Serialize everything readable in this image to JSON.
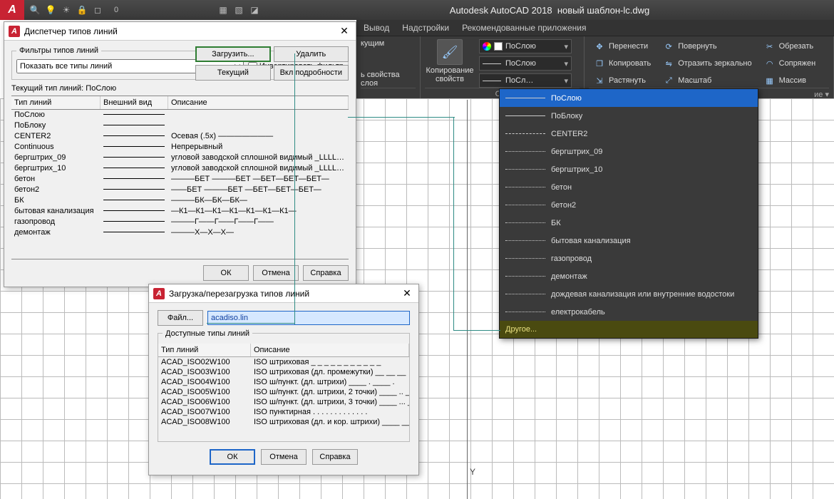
{
  "app": {
    "name": "Autodesk AutoCAD 2018",
    "doc": "новый шаблон-lc.dwg",
    "layer0": "0"
  },
  "menu": {
    "items": [
      "Вывод",
      "Надстройки",
      "Рекомендованные приложения"
    ]
  },
  "ribbon": {
    "panel_layer": {
      "btn1": "кущим",
      "btn2": "ь свойства слоя"
    },
    "panel_props": {
      "copy": "Копирование\nсвойств",
      "color": "ПоСлою",
      "linetype": "ПоСлою",
      "lw": "ПоСл…",
      "foot": "Сво"
    },
    "modify": {
      "c1": [
        "Перенести",
        "Копировать",
        "Растянуть"
      ],
      "c2": [
        "Повернуть",
        "Отразить зеркально",
        "Масштаб"
      ],
      "c3": [
        "Обрезать",
        "Сопряжен",
        "Массив"
      ],
      "foot": "ие ▾"
    }
  },
  "dropdown": {
    "items": [
      "ПоСлою",
      "ПоБлоку",
      "CENTER2",
      "бергштрих_09",
      "бергштрих_10",
      "бетон",
      "бетон2",
      "БК",
      "бытовая канализация",
      "газопровод",
      "демонтаж",
      "дождевая канализация или внутренние водостоки",
      "електрокабель"
    ],
    "other": "Другое..."
  },
  "dlg1": {
    "title": "Диспетчер типов линий",
    "filters_label": "Фильтры типов линий",
    "filter_value": "Показать все типы линий",
    "invert": "Инвертировать фильтр",
    "btn_load": "Загрузить...",
    "btn_delete": "Удалить",
    "btn_current": "Текущий",
    "btn_details": "Вкл подробности",
    "current_label": "Текущий тип линий:",
    "current_value": "ПоСлою",
    "col1": "Тип линий",
    "col2": "Внешний вид",
    "col3": "Описание",
    "rows": [
      {
        "n": "ПоСлою",
        "d": ""
      },
      {
        "n": "ПоБлоку",
        "d": ""
      },
      {
        "n": "CENTER2",
        "d": "Осевая (.5x) ———————"
      },
      {
        "n": "Continuous",
        "d": "Непрерывный"
      },
      {
        "n": "бергштрих_09",
        "d": "угловой заводской сплошной видимый _LLLLLLL"
      },
      {
        "n": "бергштрих_10",
        "d": "угловой заводской сплошной видимый _LLLLLLL"
      },
      {
        "n": "бетон",
        "d": "———БЕТ ———БЕТ —БЕТ—БЕТ—БЕТ—"
      },
      {
        "n": "бетон2",
        "d": "——БЕТ ———БЕТ —БЕТ—БЕТ—БЕТ—"
      },
      {
        "n": "БК",
        "d": "———БК—БК—БК—"
      },
      {
        "n": "бытовая канализация",
        "d": "—К1—К1—К1—К1—К1—К1—К1—"
      },
      {
        "n": "газопровод",
        "d": "———Г——Г——Г——Г——"
      },
      {
        "n": "демонтаж",
        "d": "———Х—Х—Х—"
      }
    ],
    "ok": "ОК",
    "cancel": "Отмена",
    "help": "Справка"
  },
  "dlg2": {
    "title": "Загрузка/перезагрузка типов линий",
    "file_btn": "Файл...",
    "file_value": "acadiso.lin",
    "avail": "Доступные типы линий",
    "col1": "Тип линий",
    "col2": "Описание",
    "rows": [
      {
        "n": "ACAD_ISO02W100",
        "d": "ISO штриховая _ _ _ _ _ _ _ _ _ _ _"
      },
      {
        "n": "ACAD_ISO03W100",
        "d": "ISO штриховая (дл. промежутки) __  __  __"
      },
      {
        "n": "ACAD_ISO04W100",
        "d": "ISO ш/пункт. (дл. штрихи) ____ . ____ ."
      },
      {
        "n": "ACAD_ISO05W100",
        "d": "ISO ш/пункт. (дл. штрихи, 2 точки) ____ .. __"
      },
      {
        "n": "ACAD_ISO06W100",
        "d": "ISO ш/пункт. (дл. штрихи, 3 точки) ____ ... __"
      },
      {
        "n": "ACAD_ISO07W100",
        "d": "ISO пунктирная . . . . . . . . . . . . ."
      },
      {
        "n": "ACAD_ISO08W100",
        "d": "ISO штриховая (дл. и кор. штрихи) ____ __"
      }
    ],
    "ok": "ОК",
    "cancel": "Отмена",
    "help": "Справка"
  }
}
